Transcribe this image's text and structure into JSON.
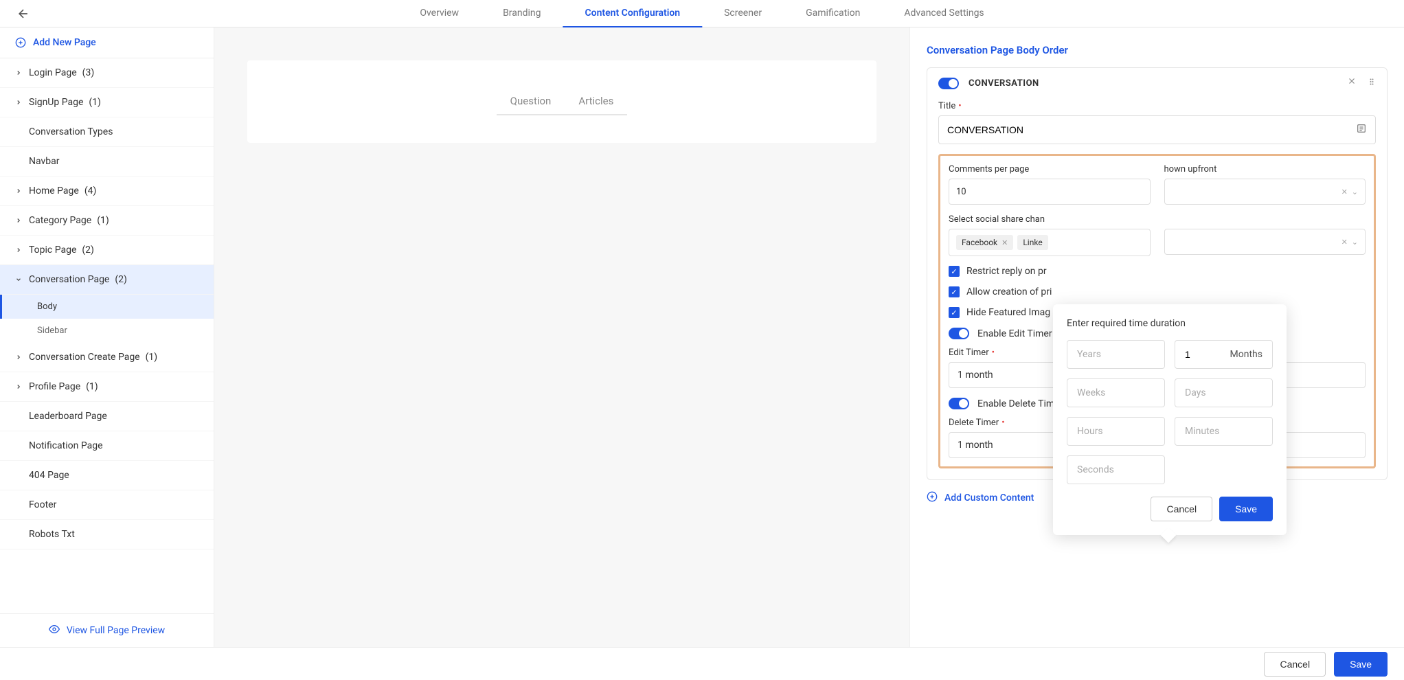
{
  "topnav": {
    "tabs": [
      "Overview",
      "Branding",
      "Content Configuration",
      "Screener",
      "Gamification",
      "Advanced Settings"
    ],
    "active_index": 2
  },
  "sidebar": {
    "add_new_label": "Add New Page",
    "items": [
      {
        "label": "Login Page",
        "count": "(3)",
        "expandable": true
      },
      {
        "label": "SignUp Page",
        "count": "(1)",
        "expandable": true
      },
      {
        "label": "Conversation Types",
        "expandable": false
      },
      {
        "label": "Navbar",
        "expandable": false
      },
      {
        "label": "Home Page",
        "count": "(4)",
        "expandable": true
      },
      {
        "label": "Category Page",
        "count": "(1)",
        "expandable": true
      },
      {
        "label": "Topic Page",
        "count": "(2)",
        "expandable": true
      },
      {
        "label": "Conversation Page",
        "count": "(2)",
        "expandable": true,
        "expanded": true,
        "children": [
          {
            "label": "Body",
            "active": true
          },
          {
            "label": "Sidebar"
          }
        ]
      },
      {
        "label": "Conversation Create Page",
        "count": "(1)",
        "expandable": true
      },
      {
        "label": "Profile Page",
        "count": "(1)",
        "expandable": true
      },
      {
        "label": "Leaderboard Page",
        "expandable": false
      },
      {
        "label": "Notification Page",
        "expandable": false
      },
      {
        "label": "404 Page",
        "expandable": false
      },
      {
        "label": "Footer",
        "expandable": false
      },
      {
        "label": "Robots Txt",
        "expandable": false
      }
    ],
    "view_preview": "View Full Page Preview"
  },
  "preview": {
    "tabs": [
      "Question",
      "Articles"
    ]
  },
  "panel": {
    "title": "Conversation Page Body Order",
    "block_label": "CONVERSATION",
    "title_field_label": "Title",
    "title_value": "CONVERSATION",
    "comments_label": "Comments per page",
    "comments_value": "10",
    "upfront_label_partial": "hown upfront",
    "social_label": "Select social share chan",
    "social_tags": [
      "Facebook",
      "Linke"
    ],
    "restrict_label": "Restrict reply on pr",
    "allow_label": "Allow creation of pri",
    "hide_label": "Hide Featured Imag",
    "enable_edit_label": "Enable Edit Timer",
    "edit_timer_label": "Edit Timer",
    "edit_timer_value": "1 month",
    "enable_delete_label": "Enable Delete Timer",
    "delete_timer_label": "Delete Timer",
    "delete_timer_value": "1 month",
    "add_custom": "Add Custom Content"
  },
  "popover": {
    "title": "Enter required time duration",
    "fields": {
      "years": {
        "placeholder": "Years",
        "value": ""
      },
      "months": {
        "placeholder": "Months",
        "value": "1"
      },
      "weeks": {
        "placeholder": "Weeks",
        "value": ""
      },
      "days": {
        "placeholder": "Days",
        "value": ""
      },
      "hours": {
        "placeholder": "Hours",
        "value": ""
      },
      "minutes": {
        "placeholder": "Minutes",
        "value": ""
      },
      "seconds": {
        "placeholder": "Seconds",
        "value": ""
      }
    },
    "cancel": "Cancel",
    "save": "Save"
  },
  "footer": {
    "cancel": "Cancel",
    "save": "Save"
  }
}
